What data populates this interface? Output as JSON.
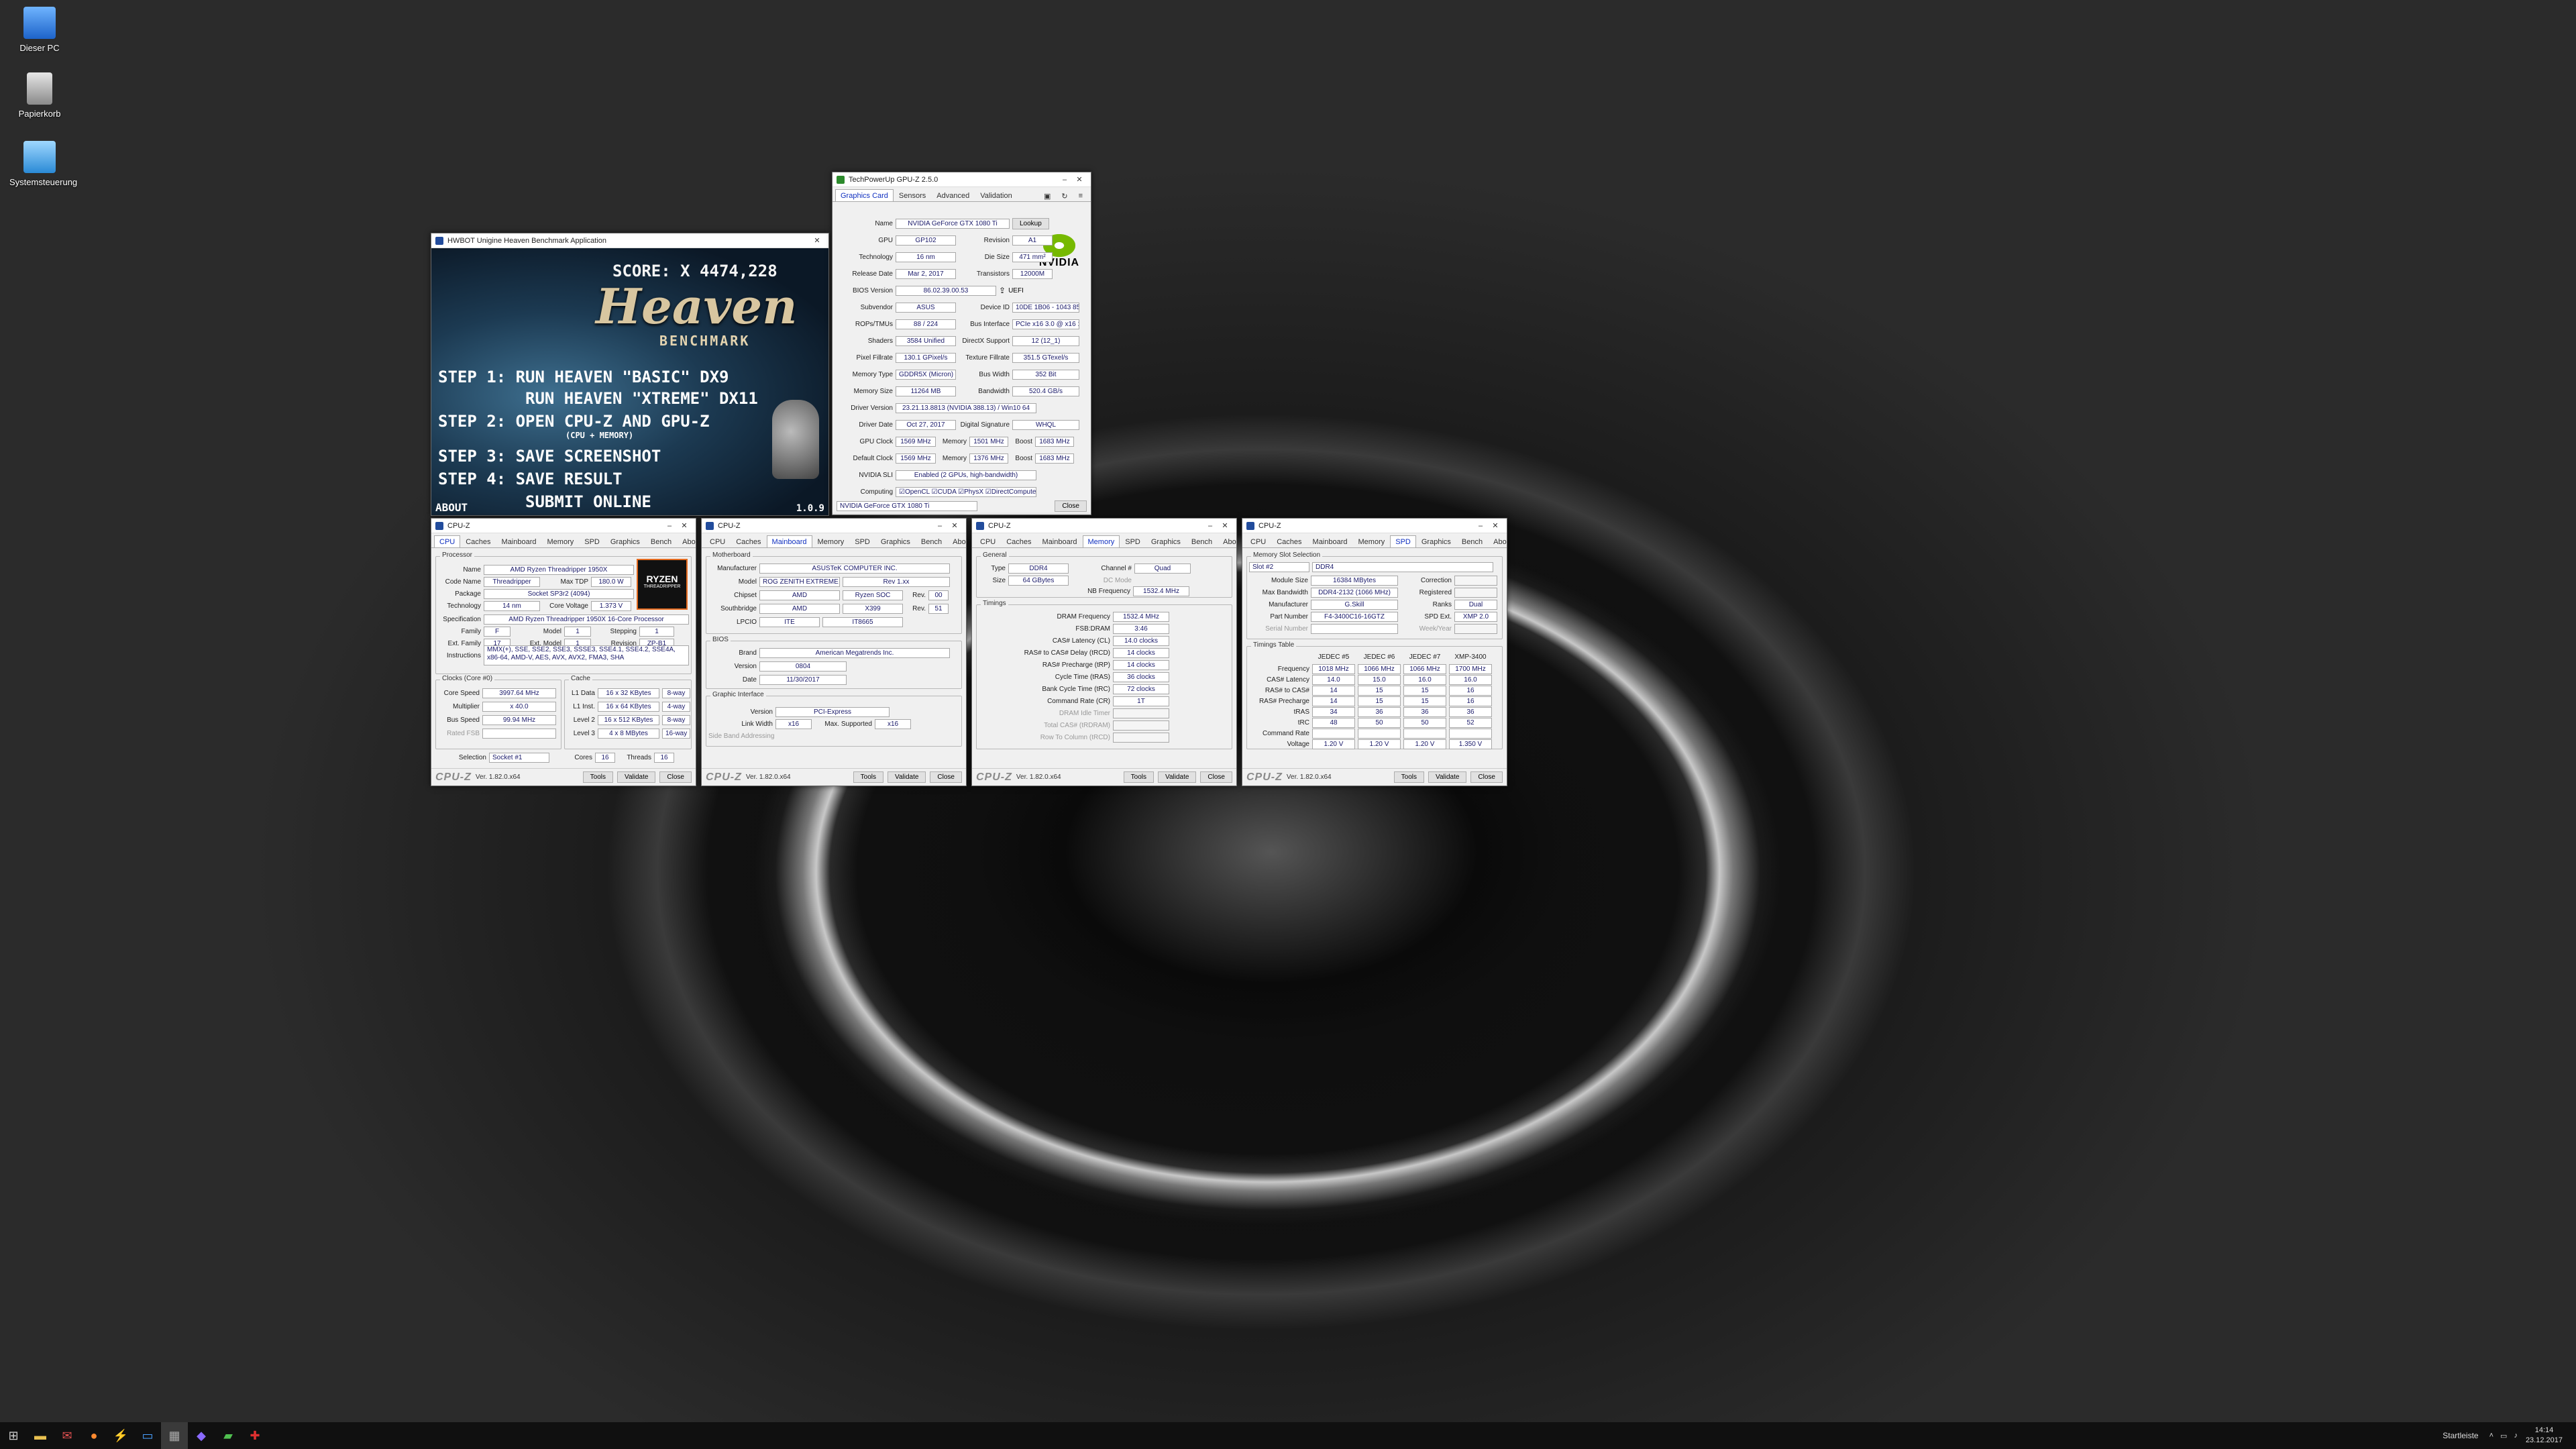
{
  "desktop": {
    "icons": [
      {
        "label": "Dieser PC",
        "icon": "computer-icon"
      },
      {
        "label": "Papierkorb",
        "icon": "recycle-bin-icon"
      },
      {
        "label": "Systemsteuerung",
        "icon": "control-panel-icon"
      }
    ]
  },
  "heaven": {
    "title": "HWBOT Unigine Heaven Benchmark Application",
    "score": "SCORE: X 4474,228",
    "logo": "Heaven",
    "logo_sub": "BENCHMARK",
    "steps": [
      "STEP 1: RUN HEAVEN \"BASIC\" DX9",
      "RUN HEAVEN \"XTREME\" DX11",
      "STEP 2: OPEN CPU-Z AND GPU-Z",
      "(CPU + MEMORY)",
      "STEP 3: SAVE SCREENSHOT",
      "STEP 4: SAVE RESULT",
      "SUBMIT ONLINE"
    ],
    "about": "ABOUT",
    "version": "1.0.9"
  },
  "gpuz": {
    "title": "TechPowerUp GPU-Z 2.5.0",
    "tabs": [
      "Graphics Card",
      "Sensors",
      "Advanced",
      "Validation"
    ],
    "rows": [
      {
        "l": "Name",
        "v": "NVIDIA GeForce GTX 1080 Ti",
        "btn": "Lookup"
      },
      {
        "l": "GPU",
        "v": "GP102",
        "l2": "Revision",
        "v2": "A1"
      },
      {
        "l": "Technology",
        "v": "16 nm",
        "l2": "Die Size",
        "v2": "471 mm²"
      },
      {
        "l": "Release Date",
        "v": "Mar 2, 2017",
        "l2": "Transistors",
        "v2": "12000M"
      },
      {
        "l": "BIOS Version",
        "v": "86.02.39.00.53",
        "chk": "UEFI"
      },
      {
        "l": "Subvendor",
        "v": "ASUS",
        "l2": "Device ID",
        "v2": "10DE 1B06 - 1043 85EA"
      },
      {
        "l": "ROPs/TMUs",
        "v": "88 / 224",
        "l2": "Bus Interface",
        "v2": "PCIe x16 3.0 @ x16 1.1"
      },
      {
        "l": "Shaders",
        "v": "3584 Unified",
        "l2": "DirectX Support",
        "v2": "12 (12_1)"
      },
      {
        "l": "Pixel Fillrate",
        "v": "130.1 GPixel/s",
        "l2": "Texture Fillrate",
        "v2": "351.5 GTexel/s"
      },
      {
        "l": "Memory Type",
        "v": "GDDR5X (Micron)",
        "l2": "Bus Width",
        "v2": "352 Bit"
      },
      {
        "l": "Memory Size",
        "v": "11264 MB",
        "l2": "Bandwidth",
        "v2": "520.4 GB/s"
      },
      {
        "l": "Driver Version",
        "v": "23.21.13.8813 (NVIDIA 388.13) / Win10 64"
      },
      {
        "l": "Driver Date",
        "v": "Oct 27, 2017",
        "l2": "Digital Signature",
        "v2": "WHQL"
      },
      {
        "l": "GPU Clock",
        "v": "1569 MHz",
        "l2": "Memory",
        "v2": "1501 MHz",
        "l3": "Boost",
        "v3": "1683 MHz"
      },
      {
        "l": "Default Clock",
        "v": "1569 MHz",
        "l2": "Memory",
        "v2": "1376 MHz",
        "l3": "Boost",
        "v3": "1683 MHz"
      },
      {
        "l": "NVIDIA SLI",
        "v": "Enabled (2 GPUs, high-bandwidth)"
      },
      {
        "l": "Computing",
        "v": "☑OpenCL ☑CUDA ☑PhysX ☑DirectCompute 5.0"
      }
    ],
    "select": "NVIDIA GeForce GTX 1080 Ti",
    "close": "Close",
    "brand": "NVIDIA"
  },
  "cpuz_common": {
    "title": "CPU-Z",
    "logo": "CPU-Z",
    "version": "Ver. 1.82.0.x64",
    "tools": "Tools",
    "validate": "Validate",
    "close": "Close",
    "tabs": [
      "CPU",
      "Caches",
      "Mainboard",
      "Memory",
      "SPD",
      "Graphics",
      "Bench",
      "About"
    ]
  },
  "cpu": {
    "processor": "Processor",
    "rows": [
      {
        "l": "Name",
        "v": "AMD Ryzen Threadripper 1950X"
      },
      {
        "l": "Code Name",
        "v": "Threadripper",
        "l2": "Max TDP",
        "v2": "180.0 W"
      },
      {
        "l": "Package",
        "v": "Socket SP3r2 (4094)"
      },
      {
        "l": "Technology",
        "v": "14 nm",
        "l2": "Core Voltage",
        "v2": "1.373 V"
      }
    ],
    "spec_l": "Specification",
    "spec": "AMD Ryzen Threadripper 1950X 16-Core Processor",
    "family": {
      "l": "Family",
      "v": "F",
      "l2": "Model",
      "v2": "1",
      "l3": "Stepping",
      "v3": "1"
    },
    "extfamily": {
      "l": "Ext. Family",
      "v": "17",
      "l2": "Ext. Model",
      "v2": "1",
      "l3": "Revision",
      "v3": "ZP-B1"
    },
    "instr_l": "Instructions",
    "instr": "MMX(+), SSE, SSE2, SSE3, SSSE3, SSE4.1, SSE4.2, SSE4A, x86-64, AMD-V, AES, AVX, AVX2, FMA3, SHA",
    "clocks_l": "Clocks (Core #0)",
    "cache_l": "Cache",
    "clocks": [
      {
        "l": "Core Speed",
        "v": "3997.64 MHz"
      },
      {
        "l": "Multiplier",
        "v": "x 40.0"
      },
      {
        "l": "Bus Speed",
        "v": "99.94 MHz"
      },
      {
        "l": "Rated FSB",
        "v": ""
      }
    ],
    "cache": [
      {
        "l": "L1 Data",
        "v": "16 x 32 KBytes",
        "w": "8-way"
      },
      {
        "l": "L1 Inst.",
        "v": "16 x 64 KBytes",
        "w": "4-way"
      },
      {
        "l": "Level 2",
        "v": "16 x 512 KBytes",
        "w": "8-way"
      },
      {
        "l": "Level 3",
        "v": "4 x 8 MBytes",
        "w": "16-way"
      }
    ],
    "selection_l": "Selection",
    "selection": "Socket #1",
    "cores_l": "Cores",
    "cores": "16",
    "threads_l": "Threads",
    "threads": "16",
    "badge1": "RYZEN",
    "badge2": "THREADRIPPER"
  },
  "mainboard": {
    "mb_l": "Motherboard",
    "rows": [
      {
        "l": "Manufacturer",
        "v": "ASUSTeK COMPUTER INC."
      },
      {
        "l": "Model",
        "v": "ROG ZENITH EXTREME",
        "v2": "Rev 1.xx"
      },
      {
        "l": "Chipset",
        "v": "AMD",
        "v2": "Ryzen SOC",
        "l3": "Rev.",
        "v3": "00"
      },
      {
        "l": "Southbridge",
        "v": "AMD",
        "v2": "X399",
        "l3": "Rev.",
        "v3": "51"
      },
      {
        "l": "LPCIO",
        "v": "ITE",
        "v2": "IT8665"
      }
    ],
    "bios_l": "BIOS",
    "bios": [
      {
        "l": "Brand",
        "v": "American Megatrends Inc."
      },
      {
        "l": "Version",
        "v": "0804"
      },
      {
        "l": "Date",
        "v": "11/30/2017"
      }
    ],
    "gi_l": "Graphic Interface",
    "gi_version_l": "Version",
    "gi_version": "PCI-Express",
    "gi_link_l": "Link Width",
    "gi_link": "x16",
    "gi_max_l": "Max. Supported",
    "gi_max": "x16",
    "gi_sba": "Side Band Addressing"
  },
  "memory": {
    "general_l": "General",
    "type_l": "Type",
    "type": "DDR4",
    "channel_l": "Channel #",
    "channel": "Quad",
    "size_l": "Size",
    "size": "64 GBytes",
    "dcmode": "DC Mode",
    "nb_l": "NB Frequency",
    "nb": "1532.4 MHz",
    "timings_l": "Timings",
    "timings": [
      {
        "l": "DRAM Frequency",
        "v": "1532.4 MHz"
      },
      {
        "l": "FSB:DRAM",
        "v": "3:46"
      },
      {
        "l": "CAS# Latency (CL)",
        "v": "14.0 clocks"
      },
      {
        "l": "RAS# to CAS# Delay (tRCD)",
        "v": "14 clocks"
      },
      {
        "l": "RAS# Precharge (tRP)",
        "v": "14 clocks"
      },
      {
        "l": "Cycle Time (tRAS)",
        "v": "36 clocks"
      },
      {
        "l": "Bank Cycle Time (tRC)",
        "v": "72 clocks"
      },
      {
        "l": "Command Rate (CR)",
        "v": "1T"
      },
      {
        "l": "DRAM Idle Timer",
        "v": ""
      },
      {
        "l": "Total CAS# (tRDRAM)",
        "v": ""
      },
      {
        "l": "Row To Column (tRCD)",
        "v": ""
      }
    ]
  },
  "spd": {
    "slot_l": "Memory Slot Selection",
    "slot": "Slot #2",
    "slot_type": "DDR4",
    "rows": [
      {
        "l": "Module Size",
        "v": "16384 MBytes",
        "l2": "Correction",
        "v2": ""
      },
      {
        "l": "Max Bandwidth",
        "v": "DDR4-2132 (1066 MHz)",
        "l2": "Registered",
        "v2": ""
      },
      {
        "l": "Manufacturer",
        "v": "G.Skill",
        "l2": "Ranks",
        "v2": "Dual"
      },
      {
        "l": "Part Number",
        "v": "F4-3400C16-16GTZ",
        "l2": "SPD Ext.",
        "v2": "XMP 2.0"
      },
      {
        "l": "Serial Number",
        "v": "",
        "l2": "Week/Year",
        "v2": ""
      }
    ],
    "tt_l": "Timings Table",
    "cols": [
      "JEDEC #5",
      "JEDEC #6",
      "JEDEC #7",
      "XMP-3400"
    ],
    "trows": [
      {
        "l": "Frequency",
        "v": [
          "1018 MHz",
          "1066 MHz",
          "1066 MHz",
          "1700 MHz"
        ]
      },
      {
        "l": "CAS# Latency",
        "v": [
          "14.0",
          "15.0",
          "16.0",
          "16.0"
        ]
      },
      {
        "l": "RAS# to CAS#",
        "v": [
          "14",
          "15",
          "15",
          "16"
        ]
      },
      {
        "l": "RAS# Precharge",
        "v": [
          "14",
          "15",
          "15",
          "16"
        ]
      },
      {
        "l": "tRAS",
        "v": [
          "34",
          "36",
          "36",
          "36"
        ]
      },
      {
        "l": "tRC",
        "v": [
          "48",
          "50",
          "50",
          "52"
        ]
      },
      {
        "l": "Command Rate",
        "v": [
          "",
          "",
          "",
          ""
        ]
      },
      {
        "l": "Voltage",
        "v": [
          "1.20 V",
          "1.20 V",
          "1.20 V",
          "1.350 V"
        ]
      }
    ]
  },
  "taskbar": {
    "startleiste": "Startleiste",
    "time": "14:14",
    "date": "23.12.2017"
  }
}
